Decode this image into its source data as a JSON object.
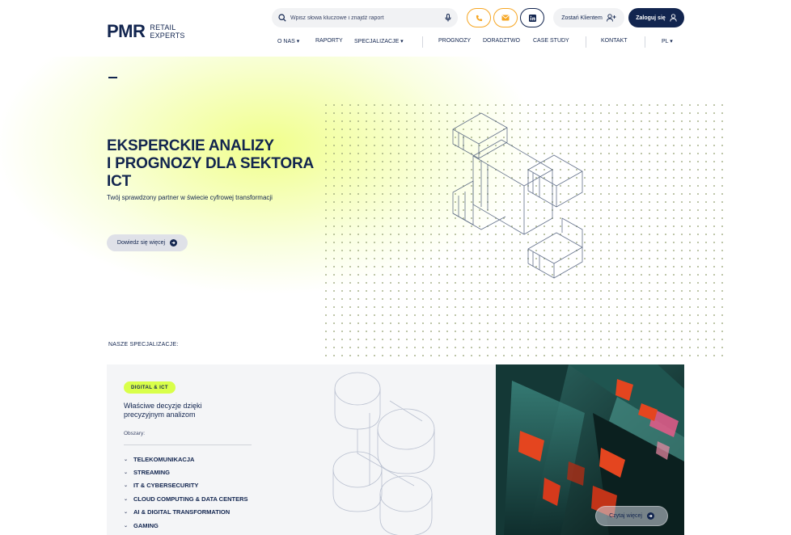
{
  "brand": {
    "logo_text": "PMR",
    "logo_subtitle_1": "RETAIL",
    "logo_subtitle_2": "EXPERTS"
  },
  "search": {
    "placeholder": "Wpisz słowa kluczowe i znajdź raport"
  },
  "header_buttons": {
    "become_client": "Zostań Klientem",
    "login": "Zaloguj się"
  },
  "nav": {
    "items": [
      {
        "label": "O NAS ▾"
      },
      {
        "label": "RAPORTY"
      },
      {
        "label": "SPECJALIZACJE ▾"
      },
      {
        "label": "PROGNOZY"
      },
      {
        "label": "DORADZTWO"
      },
      {
        "label": "CASE STUDY"
      },
      {
        "label": "KONTAKT"
      },
      {
        "label": "PL ▾"
      }
    ]
  },
  "hero": {
    "title_line_1": "EKSPERCKIE ANALIZY",
    "title_line_2": "I PROGNOZY DLA SEKTORA",
    "title_line_3": "ICT",
    "subtitle": "Twój sprawdzony partner w świecie cyfrowej transformacji",
    "cta": "Dowiedz się więcej"
  },
  "specializations": {
    "label": "NASZE SPECJALIZACJE:",
    "card": {
      "badge": "DIGITAL & ICT",
      "title": "Właściwe decyzje dzięki precyzyjnym analizom",
      "areas_label": "Obszary:",
      "areas": [
        "TELEKOMUNIKACJA",
        "STREAMING",
        "IT & CYBERSECURITY",
        "CLOUD COMPUTING & DATA CENTERS",
        "AI & DIGITAL TRANSFORMATION",
        "GAMING"
      ],
      "read_more": "Czytaj więcej"
    }
  },
  "colors": {
    "navy": "#12254f",
    "accent_lime": "#d9ff4a",
    "accent_orange": "#f6a623",
    "card_bg": "#f4f5f7"
  }
}
